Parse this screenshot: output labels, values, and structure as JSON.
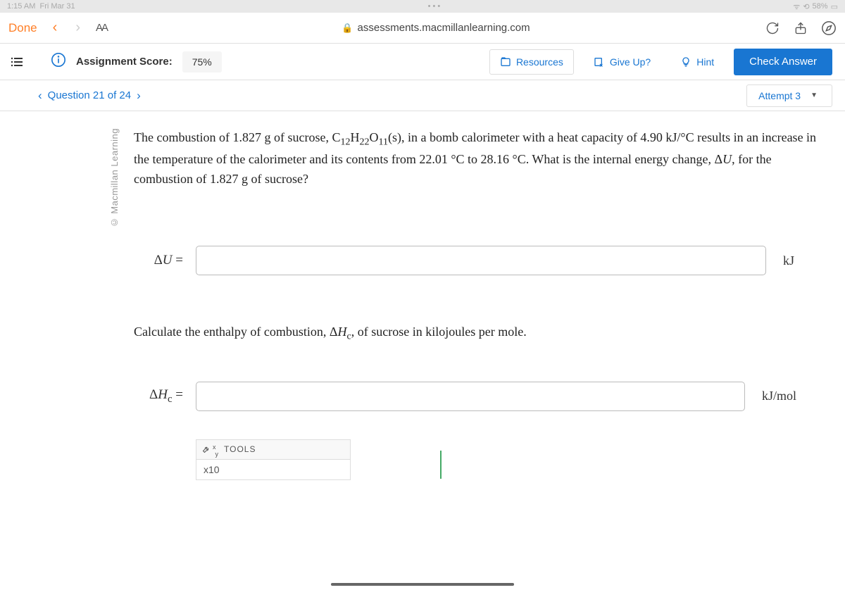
{
  "status": {
    "time": "1:15 AM",
    "date": "Fri Mar 31",
    "battery": "58%"
  },
  "browser": {
    "done": "Done",
    "aa": "AA",
    "url": "assessments.macmillanlearning.com"
  },
  "header": {
    "score_label": "Assignment Score:",
    "score_value": "75%",
    "resources": "Resources",
    "give_up": "Give Up?",
    "hint": "Hint",
    "check": "Check Answer"
  },
  "qnav": {
    "label": "Question 21 of 24",
    "attempt": "Attempt 3"
  },
  "copyright": "© Macmillan Learning",
  "question": {
    "p1a": "The combustion of 1.827 g of sucrose, C",
    "f_c": "12",
    "f_h": "H",
    "f_hn": "22",
    "f_o": "O",
    "f_on": "11",
    "p1b": "(s), in a bomb calorimeter with a heat capacity of 4.90 kJ/°C results in an increase in the temperature of the calorimeter and its contents from 22.01 °C to 28.16 °C. What is the internal energy change, Δ",
    "p1c": ", for the combustion of 1.827 g of sucrose?",
    "ans1_label_a": "Δ",
    "ans1_label_u": "U",
    "ans1_eq": " =",
    "unit1": "kJ",
    "p2a": "Calculate the enthalpy of combustion, Δ",
    "p2b": ", of sucrose in kilojoules per mole.",
    "ans2_label_a": "Δ",
    "ans2_label_h": "H",
    "ans2_sub": "c",
    "ans2_eq": " =",
    "unit2": "kJ/mol"
  },
  "tools": {
    "title": "TOOLS",
    "item": "x10"
  }
}
